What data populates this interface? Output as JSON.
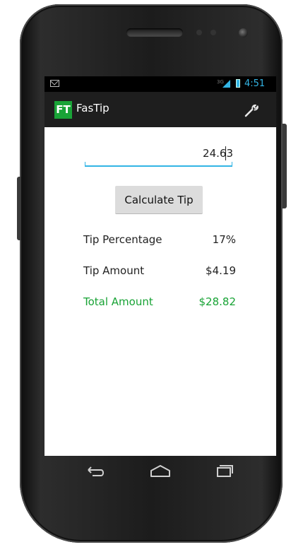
{
  "status_bar": {
    "network": "3G",
    "time": "4:51"
  },
  "action_bar": {
    "logo": "FT",
    "title": "FasTip",
    "settings_icon": "wrench-icon"
  },
  "bill_input": {
    "value": "24.63"
  },
  "calculate_button": {
    "label": "Calculate Tip"
  },
  "results": [
    {
      "label": "Tip Percentage",
      "value": "17%"
    },
    {
      "label": "Tip Amount",
      "value": "$4.19"
    },
    {
      "label": "Total Amount",
      "value": "$28.82"
    }
  ],
  "colors": {
    "accent": "#33b5e5",
    "brand_green": "#19a337",
    "total_green": "#18a335"
  },
  "nav_bar": {
    "icons": [
      "back-icon",
      "home-icon",
      "recent-apps-icon"
    ]
  }
}
